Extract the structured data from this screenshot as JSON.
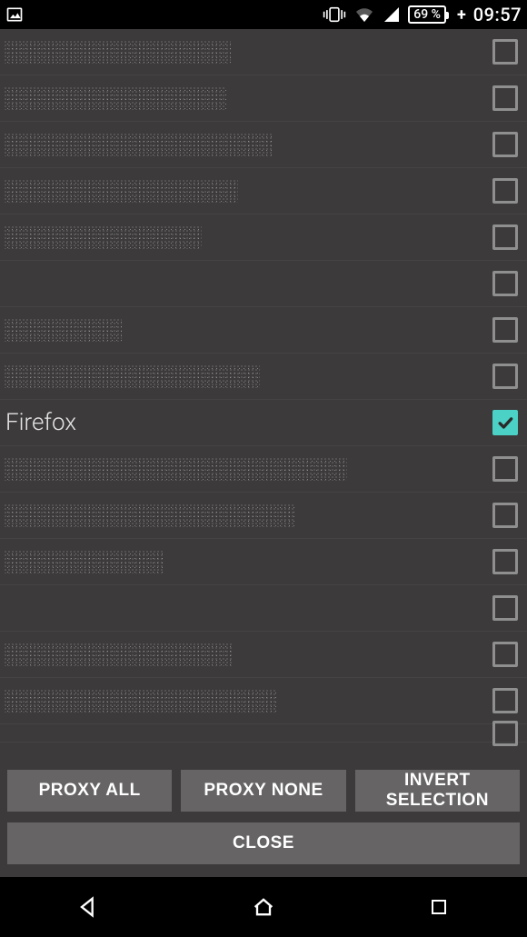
{
  "status": {
    "battery_text": "69 %",
    "clock": "09:57"
  },
  "apps": [
    {
      "label": "",
      "redact_w": 250,
      "checked": false
    },
    {
      "label": "",
      "redact_w": 245,
      "checked": false
    },
    {
      "label": "",
      "redact_w": 295,
      "checked": false
    },
    {
      "label": "",
      "redact_w": 258,
      "checked": false
    },
    {
      "label": "",
      "redact_w": 218,
      "checked": false
    },
    {
      "label": "",
      "redact_w": 0,
      "checked": false
    },
    {
      "label": "",
      "redact_w": 130,
      "checked": false
    },
    {
      "label": "",
      "redact_w": 282,
      "checked": false
    },
    {
      "label": "Firefox",
      "redact_w": 0,
      "checked": true
    },
    {
      "label": "",
      "redact_w": 378,
      "checked": false
    },
    {
      "label": "",
      "redact_w": 320,
      "checked": false
    },
    {
      "label": "",
      "redact_w": 175,
      "checked": false
    },
    {
      "label": "",
      "redact_w": 0,
      "checked": false
    },
    {
      "label": "",
      "redact_w": 252,
      "checked": false
    },
    {
      "label": "",
      "redact_w": 300,
      "checked": false
    },
    {
      "label": "",
      "redact_w": 0,
      "checked": false,
      "partial": true
    }
  ],
  "buttons": {
    "proxy_all": "PROXY ALL",
    "proxy_none": "PROXY NONE",
    "invert": "INVERT SELECTION",
    "close": "CLOSE"
  },
  "colors": {
    "accent": "#4bd1c5"
  }
}
